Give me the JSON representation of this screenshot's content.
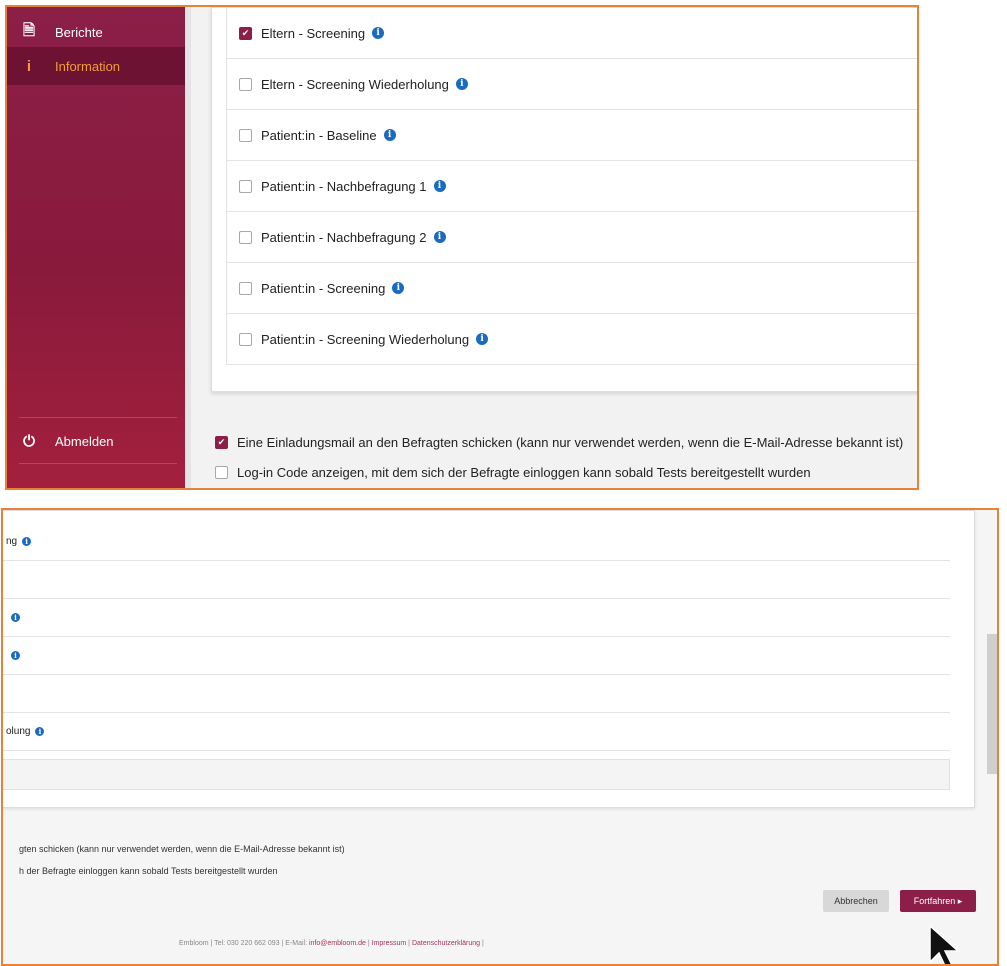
{
  "sidebar": {
    "items": [
      {
        "label": "Berichte",
        "icon": "reports-icon"
      },
      {
        "label": "Information",
        "icon": "info-icon"
      },
      {
        "label": "Abmelden",
        "icon": "logout-icon"
      }
    ],
    "accent": "#8b1f47",
    "active_color": "#f39c3c"
  },
  "questionnaires": [
    {
      "label": "Eltern - Screening",
      "checked": true
    },
    {
      "label": "Eltern - Screening Wiederholung",
      "checked": false
    },
    {
      "label": "Patient:in - Baseline",
      "checked": false
    },
    {
      "label": "Patient:in - Nachbefragung 1",
      "checked": false
    },
    {
      "label": "Patient:in - Nachbefragung 2",
      "checked": false
    },
    {
      "label": "Patient:in - Screening",
      "checked": false
    },
    {
      "label": "Patient:in - Screening Wiederholung",
      "checked": false
    }
  ],
  "options": {
    "invite_mail": {
      "label": "Eine Einladungsmail an den Befragten schicken (kann nur verwendet werden, wenn die E-Mail-Adresse bekannt ist)",
      "checked": true
    },
    "login_code": {
      "label": "Log-in Code anzeigen, mit dem sich der Befragte einloggen kann sobald Tests bereitgestellt wurden",
      "checked": false
    }
  },
  "zoomed": {
    "rows": [
      "ng",
      "",
      "",
      "",
      "",
      "olung"
    ],
    "option1": "gten schicken (kann nur verwendet werden, wenn die E-Mail-Adresse bekannt ist)",
    "option2": "h der Befragte einloggen kann sobald Tests bereitgestellt wurden",
    "cancel_label": "Abbrechen",
    "continue_label": "Fortfahren ▸",
    "footer_prefix": "Embloom | Tel: 030 220 662 093 | E-Mail: ",
    "footer_email": "info@embloom.de",
    "footer_sep": " | ",
    "footer_imprint": "Impressum",
    "footer_privacy": "Datenschutzerklärung",
    "footer_end": " |"
  }
}
